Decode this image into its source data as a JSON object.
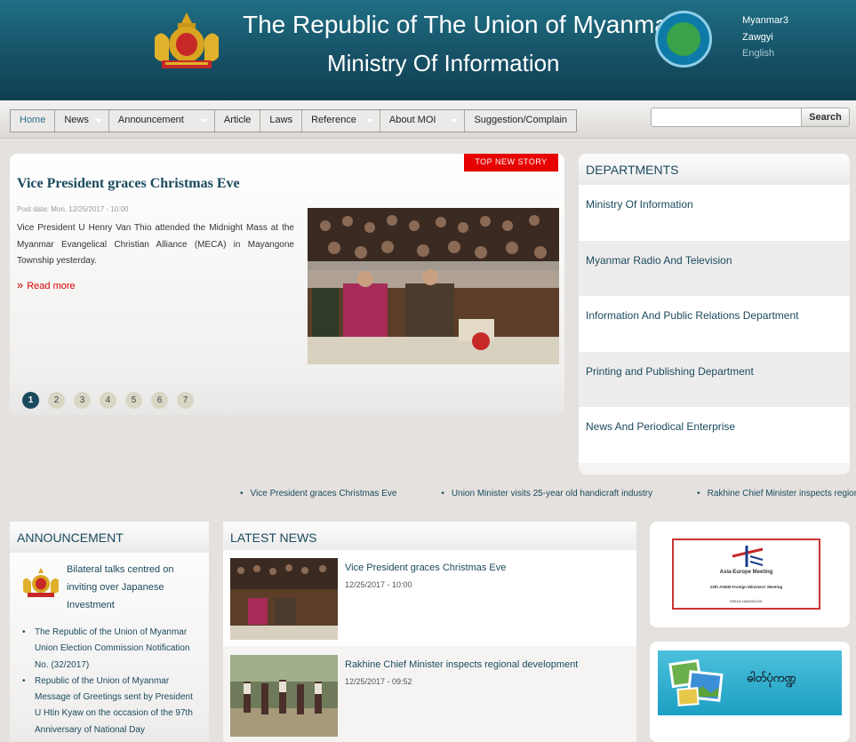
{
  "header": {
    "title_line1": "The Republic of The Union of Myanmar",
    "title_line2": "Ministry Of Information",
    "emblem_icon": "state-emblem-icon",
    "seal_icon": "ministry-seal-icon",
    "languages": [
      "Myanmar3",
      "Zawgyi",
      "English"
    ]
  },
  "nav": {
    "items": [
      "Home",
      "News",
      "Announcement",
      "Article",
      "Laws",
      "Reference",
      "About MOI",
      "Suggestion/Complain"
    ],
    "search_placeholder": "",
    "search_button": "Search"
  },
  "top_story": {
    "badge": "TOP NEW STORY",
    "title": "Vice President graces Christmas Eve",
    "date": "Post date: Mon, 12/25/2017 - 10:00",
    "text": "Vice President U Henry Van Thio attended the Midnight Mass at the Myanmar Evangelical Christian Alliance (MECA) in Mayangone Township yesterday.",
    "read_more": "Read more",
    "pages": [
      "1",
      "2",
      "3",
      "4",
      "5",
      "6",
      "7"
    ]
  },
  "departments": {
    "heading": "DEPARTMENTS",
    "items": [
      "Ministry Of Information",
      "Myanmar Radio And Television",
      "Information And Public Relations Department",
      "Printing and Publishing Department",
      "News And Periodical Enterprise"
    ]
  },
  "ticker": [
    "Vice President graces Christmas Eve",
    "Union Minister visits 25-year old handicraft industry",
    "Rakhine Chief Minister inspects regional development"
  ],
  "announcement": {
    "heading": "ANNOUNCEMENT",
    "featured": "Bilateral talks centred on inviting over Japanese Investment",
    "items": [
      "The Republic of the Union of Myanmar Union Election Commission Notification No. (32/2017)",
      "Republic of the Union of Myanmar Message of Greetings sent by President U Htin Kyaw on the occasion of the 97th Anniversary of National Day"
    ]
  },
  "latest_news": {
    "heading": "LATEST NEWS",
    "items": [
      {
        "title": "Vice President graces Christmas Eve",
        "date": "12/25/2017 - 10:00"
      },
      {
        "title": "Rakhine Chief Minister inspects regional development",
        "date": "12/25/2017 - 09:52"
      }
    ]
  },
  "ads": {
    "asem_title": "Asia-Europe Meeting",
    "asem_subtitle": "13th ASEM Foreign Ministers' Meeting",
    "asem_footer": "MEDIA HANDBOOK",
    "gallery_label": "ဓါတ်ပုံကဏ္ဍ"
  }
}
